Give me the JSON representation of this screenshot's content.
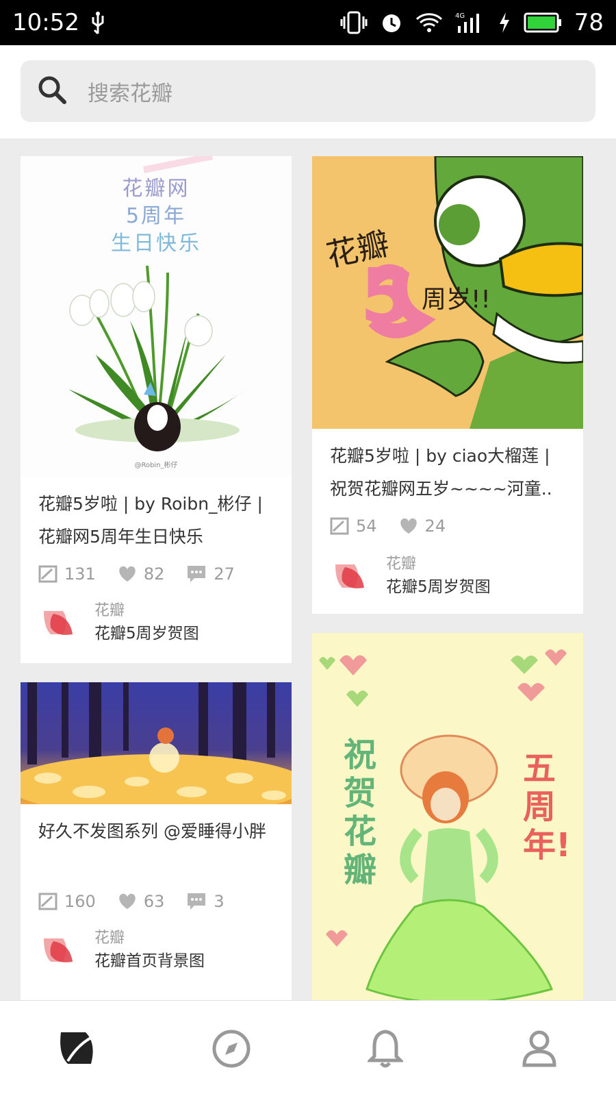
{
  "status_bar": {
    "time": "10:52",
    "battery": "78"
  },
  "search": {
    "placeholder": "搜索花瓣"
  },
  "cards": [
    {
      "image_text": [
        "花瓣网",
        "5周年",
        "生日快乐"
      ],
      "image_credit": "@Robin_彬仔",
      "title": "花瓣5岁啦 | by Roibn_彬仔 | 花瓣网5周年生日快乐",
      "repins": "131",
      "likes": "82",
      "comments": "27",
      "board_owner": "花瓣",
      "board_name": "花瓣5周岁贺图"
    },
    {
      "image_text": [
        "花瓣",
        "5",
        "周岁!!"
      ],
      "title": "花瓣5岁啦 | by ciao大榴莲 | 祝贺花瓣网五岁~~~~河童..",
      "repins": "54",
      "likes": "24",
      "board_owner": "花瓣",
      "board_name": "花瓣5周岁贺图"
    },
    {
      "title": "好久不发图系列 @爱睡得小胖",
      "repins": "160",
      "likes": "63",
      "comments": "3",
      "board_owner": "花瓣",
      "board_name": "花瓣首页背景图"
    },
    {
      "image_text": [
        "祝贺花瓣",
        "五周年!"
      ]
    }
  ],
  "colors": {
    "accent": "#e8414a",
    "background": "#ececec",
    "card": "#ffffff"
  },
  "bottom_nav": [
    "home-icon",
    "explore-icon",
    "notifications-icon",
    "profile-icon"
  ]
}
